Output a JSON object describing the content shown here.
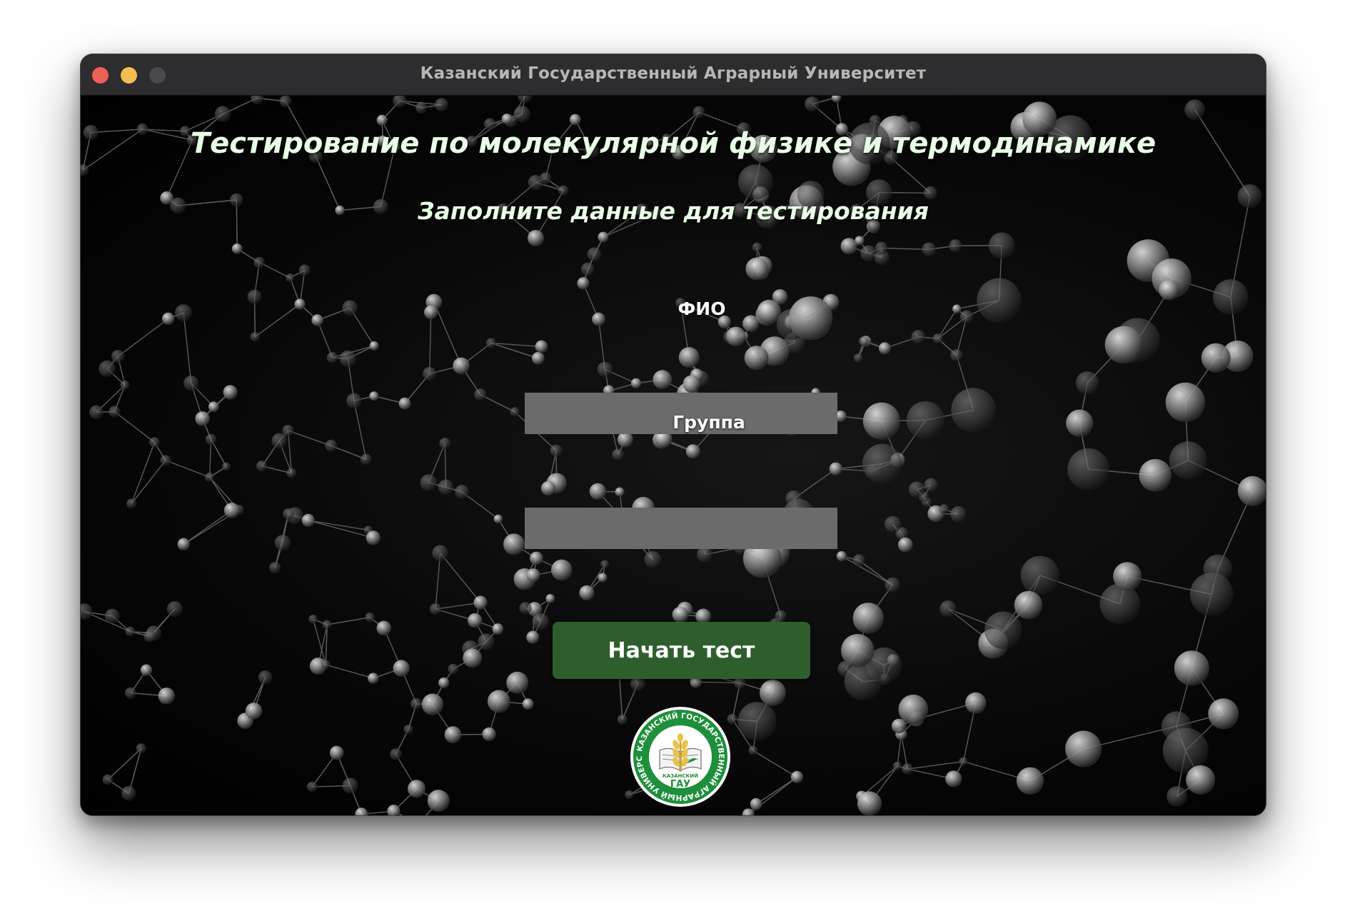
{
  "window": {
    "title": "Казанский Государственный Аграрный Университет",
    "controls": {
      "close_icon": "close-circle",
      "minimize_icon": "minimize-circle",
      "maximize_icon": "maximize-circle"
    }
  },
  "main": {
    "heading": "Тестирование по молекулярной физике и термодинамике",
    "subheading": "Заполните данные для тестирования",
    "fields": {
      "fio": {
        "label": "ФИО",
        "value": "",
        "placeholder": ""
      },
      "group": {
        "label": "Группа",
        "value": "",
        "placeholder": ""
      }
    },
    "start_button_label": "Начать тест",
    "logo": {
      "ring_text": "КАЗАНСКИЙ ГОСУДАРСТВЕННЫЙ АГРАРНЫЙ УНИВЕРСИТЕТ",
      "inner_small": "КАЗАНСКИЙ",
      "inner_big": "ГАУ"
    }
  },
  "colors": {
    "titlebar": "#2d2d2f",
    "heading_text": "#e8ffe6",
    "input_bg": "#6b6b6b",
    "button_bg": "#2e5e2c",
    "logo_green": "#1e8f3a",
    "logo_yellow": "#e9c24a"
  },
  "background": {
    "description_icon": "molecule-network-background"
  }
}
